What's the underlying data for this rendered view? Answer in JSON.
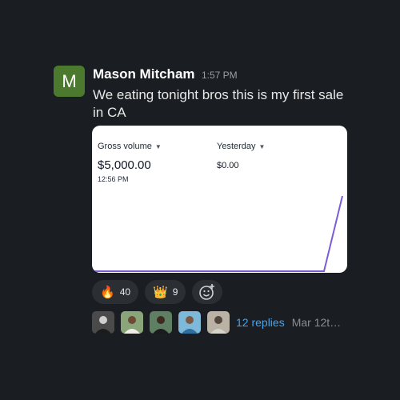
{
  "message": {
    "avatar_initial": "M",
    "author": "Mason Mitcham",
    "time": "1:57 PM",
    "text": "We eating tonight bros this is my first sale in CA"
  },
  "card": {
    "metrics": [
      {
        "label": "Gross volume",
        "value": "$5,000.00"
      },
      {
        "label": "Yesterday",
        "value": "$0.00"
      }
    ],
    "timestamp": "12:56 PM"
  },
  "reactions": [
    {
      "emoji": "🔥",
      "icon": "fire-icon",
      "count": "40"
    },
    {
      "emoji": "👑",
      "icon": "crown-icon",
      "count": "9"
    }
  ],
  "thread": {
    "participants": [
      "participant-1",
      "participant-2",
      "participant-3",
      "participant-4",
      "participant-5"
    ],
    "replies_label": "12 replies",
    "last_reply": "Mar 12t…"
  },
  "colors": {
    "avatar_bg": "#4b7a2e",
    "line": "#7b5cd6",
    "link": "#4ba3e8"
  }
}
